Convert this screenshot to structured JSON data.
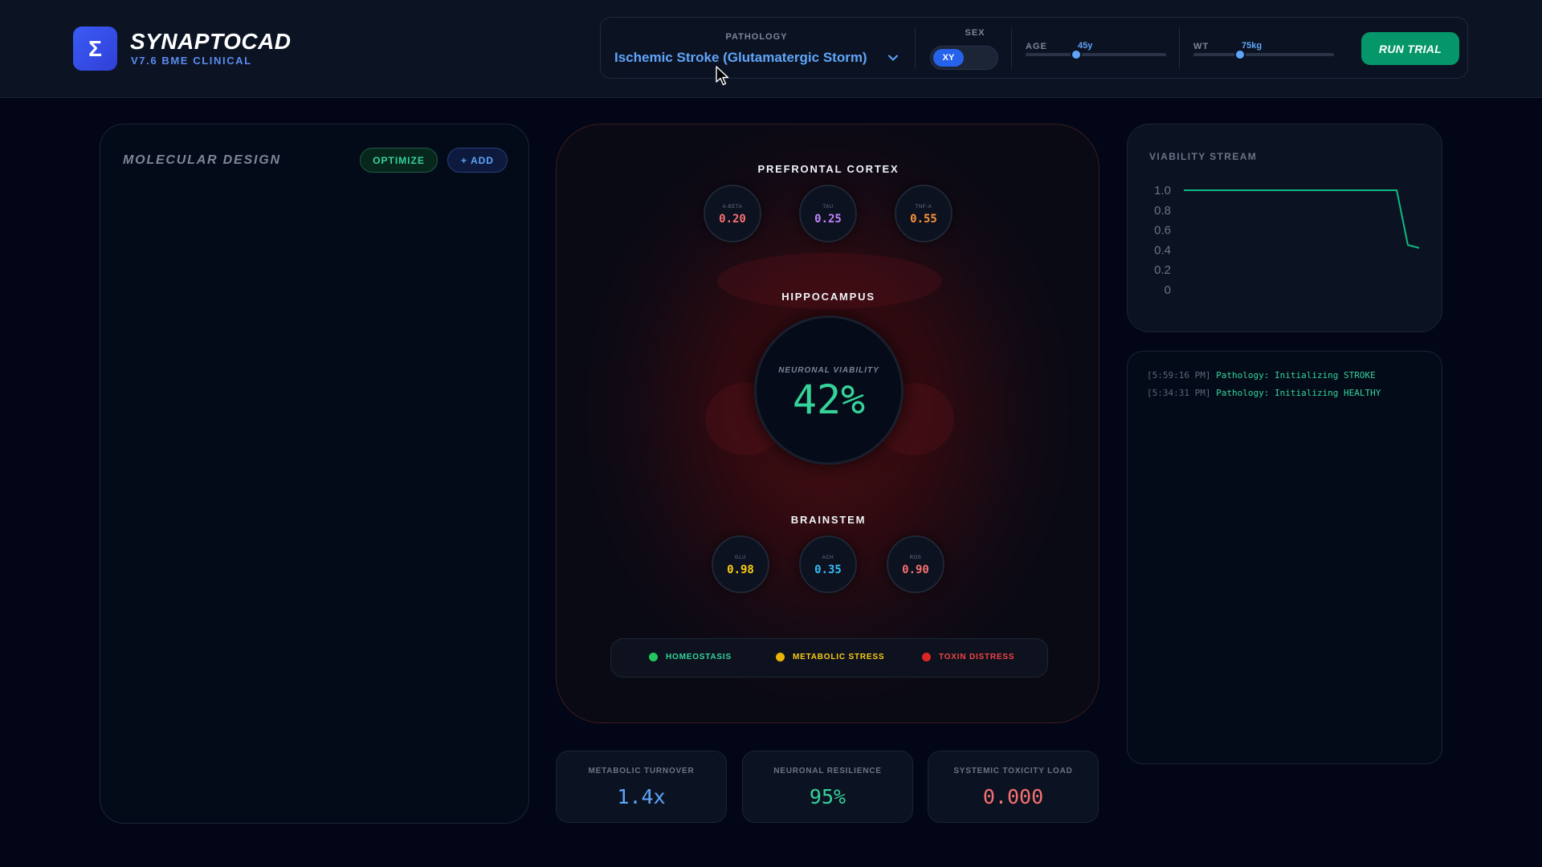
{
  "app": {
    "name": "SYNAPTOCAD",
    "version": "V7.6 BME CLINICAL",
    "logo_symbol": "Σ"
  },
  "controls": {
    "pathology_label": "PATHOLOGY",
    "pathology_value": "Ischemic Stroke (Glutamatergic Storm)",
    "sex_label": "SEX",
    "sex_value": "XY",
    "age_label": "AGE",
    "age_value": "45y",
    "weight_label": "WT",
    "weight_value": "75kg",
    "run_label": "RUN TRIAL"
  },
  "molecular": {
    "title": "MOLECULAR DESIGN",
    "optimize_label": "OPTIMIZE",
    "add_label": "+ ADD"
  },
  "brain": {
    "prefrontal": {
      "title": "PREFRONTAL CORTEX",
      "nodes": [
        {
          "label": "A-BETA",
          "value": "0.20",
          "color": "#f87171"
        },
        {
          "label": "TAU",
          "value": "0.25",
          "color": "#c084fc"
        },
        {
          "label": "TNF-A",
          "value": "0.55",
          "color": "#fb923c"
        }
      ]
    },
    "hippocampus": {
      "title": "HIPPOCAMPUS",
      "label": "NEURONAL VIABILITY",
      "value": "42%"
    },
    "brainstem": {
      "title": "BRAINSTEM",
      "nodes": [
        {
          "label": "GLU",
          "value": "0.98",
          "color": "#facc15"
        },
        {
          "label": "ACH",
          "value": "0.35",
          "color": "#38bdf8"
        },
        {
          "label": "ROS",
          "value": "0.90",
          "color": "#f87171"
        }
      ]
    },
    "legend": [
      {
        "label": "HOMEOSTASIS",
        "color": "#22c55e"
      },
      {
        "label": "METABOLIC STRESS",
        "color": "#eab308"
      },
      {
        "label": "TOXIN DISTRESS",
        "color": "#dc2626"
      }
    ]
  },
  "metrics": [
    {
      "label": "METABOLIC TURNOVER",
      "value": "1.4x",
      "color": "#60a5fa"
    },
    {
      "label": "NEURONAL RESILIENCE",
      "value": "95%",
      "color": "#34d399"
    },
    {
      "label": "SYSTEMIC TOXICITY LOAD",
      "value": "0.000",
      "color": "#f87171"
    }
  ],
  "stream": {
    "title": "VIABILITY STREAM",
    "line_color": "#10b981"
  },
  "log": [
    {
      "time": "[5:59:16 PM]",
      "message": "Pathology: Initializing STROKE"
    },
    {
      "time": "[5:34:31 PM]",
      "message": "Pathology: Initializing HEALTHY"
    }
  ],
  "chart_data": {
    "type": "line",
    "title": "VIABILITY STREAM",
    "ylim": [
      0,
      1.0
    ],
    "yticks": [
      "1.0",
      "0.8",
      "0.6",
      "0.4",
      "0.2",
      "0"
    ],
    "series": [
      {
        "values": [
          1.0,
          1.0,
          1.0,
          1.0,
          1.0,
          1.0,
          1.0,
          1.0,
          1.0,
          1.0,
          1.0,
          1.0,
          1.0,
          1.0,
          1.0,
          1.0,
          1.0,
          1.0,
          1.0,
          1.0,
          0.45,
          0.42
        ]
      }
    ]
  }
}
